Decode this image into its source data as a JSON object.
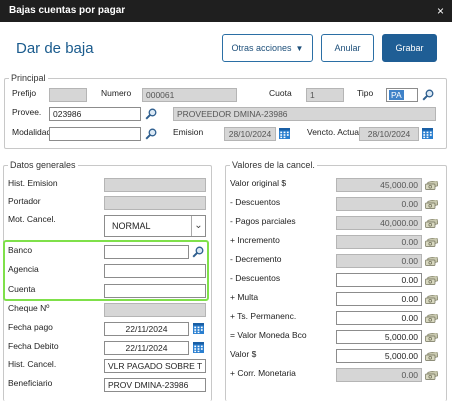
{
  "window": {
    "title": "Bajas cuentas por pagar",
    "close_glyph": "×"
  },
  "heading": "Dar de baja",
  "toolbar": {
    "otras_acciones": "Otras acciones",
    "anular": "Anular",
    "grabar": "Grabar",
    "caret": "▼"
  },
  "principal": {
    "legend": "Principal",
    "prefijo_label": "Prefijo",
    "prefijo_value": "",
    "numero_label": "Numero",
    "numero_value": "000061",
    "cuota_label": "Cuota",
    "cuota_value": "1",
    "tipo_label": "Tipo",
    "tipo_value": "PA",
    "provee_label": "Provee.",
    "provee_code": "023986",
    "provee_name": "PROVEEDOR DMINA-23986",
    "modalidad_label": "Modalidad",
    "modalidad_value": "",
    "emision_label": "Emision",
    "emision_value": "28/10/2024",
    "vencto_label": "Vencto. Actual",
    "vencto_value": "28/10/2024"
  },
  "datos_generales": {
    "legend": "Datos generales",
    "hist_emision_label": "Hist. Emision",
    "hist_emision_value": "",
    "portador_label": "Portador",
    "portador_value": "",
    "mot_cancel_label": "Mot. Cancel.",
    "mot_cancel_value": "NORMAL",
    "banco_label": "Banco",
    "banco_value": "",
    "agencia_label": "Agencia",
    "agencia_value": "",
    "cuenta_label": "Cuenta",
    "cuenta_value": "",
    "cheque_label": "Cheque Nº",
    "cheque_value": "",
    "fecha_pago_label": "Fecha pago",
    "fecha_pago_value": "22/11/2024",
    "fecha_debito_label": "Fecha Debito",
    "fecha_debito_value": "22/11/2024",
    "hist_cancel_label": "Hist. Cancel.",
    "hist_cancel_value": "VLR PAGADO SOBRE T",
    "beneficiario_label": "Beneficiario",
    "beneficiario_value": "PROV DMINA-23986"
  },
  "valores": {
    "legend": "Valores de la cancel.",
    "rows": [
      {
        "label": "Valor original $",
        "value": "45,000.00",
        "readonly": true
      },
      {
        "label": "- Descuentos",
        "value": "0.00",
        "readonly": true
      },
      {
        "label": "- Pagos parciales",
        "value": "40,000.00",
        "readonly": true
      },
      {
        "label": "+ Incremento",
        "value": "0.00",
        "readonly": true
      },
      {
        "label": "- Decremento",
        "value": "0.00",
        "readonly": true
      },
      {
        "label": "- Descuentos",
        "value": "0.00",
        "readonly": false
      },
      {
        "label": "+ Multa",
        "value": "0.00",
        "readonly": false
      },
      {
        "label": "+ Ts. Permanenc.",
        "value": "0.00",
        "readonly": false
      },
      {
        "label": "= Valor Moneda Bco",
        "value": "5,000.00",
        "readonly": false
      },
      {
        "label": "Valor $",
        "value": "5,000.00",
        "readonly": false
      },
      {
        "label": "+ Corr. Monetaria",
        "value": "0.00",
        "readonly": true
      }
    ]
  },
  "colors": {
    "titlebar": "#1f1f1f",
    "accent": "#1f5e95",
    "heading": "#1a5b8d",
    "highlight": "#7fe04a",
    "tipo_field": "#3f82c8"
  }
}
